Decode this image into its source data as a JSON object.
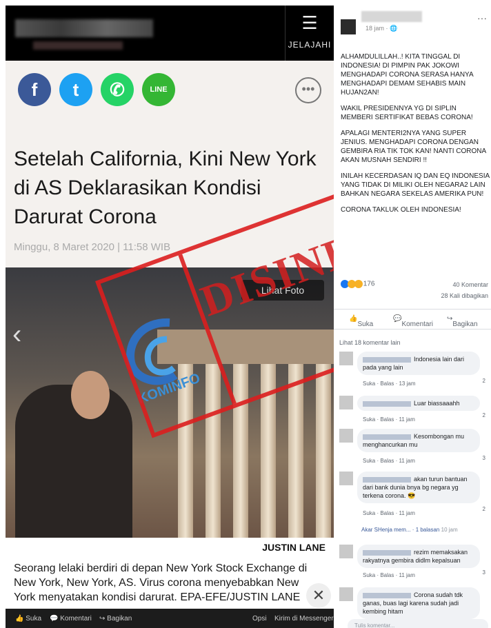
{
  "left_panel": {
    "explore_label": "JELAJAHI",
    "more_label": "•••",
    "share_icons": [
      "f",
      "t",
      "✆",
      "LINE"
    ],
    "headline": "Setelah California, Kini New York di AS Deklarasikan Kondisi Darurat Corona",
    "date": "Minggu, 8 Maret 2020 | 11:58 WIB",
    "view_photo": "Lihat Foto",
    "photo_credit": "JUSTIN LANE",
    "caption": "Seorang lelaki berdiri di depan New York Stock Exchange di New York, New York, AS. Virus corona menyebabkan New York menyatakan kondisi darurat. EPA-EFE/JUSTIN LANE",
    "stamp_text": "DISINFORMASI",
    "watermark": "KOMINFO",
    "bottom_bar": {
      "like": "Suka",
      "comment": "Komentari",
      "share": "Bagikan",
      "options": "Opsi",
      "messenger": "Kirim di Messenger"
    }
  },
  "post": {
    "time": "18 jam",
    "paragraphs": [
      "ALHAMDULILLAH..! KITA TINGGAL DI INDONESIA! DI PIMPIN PAK JOKOWI MENGHADAPI CORONA SERASA HANYA MENGHADAPI DEMAM SEHABIS MAIN HUJAN2AN!",
      "WAKIL PRESIDENNYA YG DI SIPLIN MEMBERI SERTIFIKAT BEBAS CORONA!",
      "APALAGI MENTERI2NYA YANG SUPER JENIUS. MENGHADAPI CORONA DENGAN GEMBIRA RIA TIK TOK KAN! NANTI CORONA AKAN MUSNAH SENDIRI !!",
      "INILAH KECERDASAN IQ DAN EQ INDONESIA YANG TIDAK DI MILIKI OLEH NEGARA2 LAIN BAHKAN NEGARA SEKELAS AMERIKA PUN!",
      "CORONA TAKLUK OLEH INDONESIA!"
    ],
    "reaction_count": "176",
    "comment_count": "40 Komentar",
    "share_count": "28 Kali dibagikan",
    "actions": {
      "like": "Suka",
      "comment": "Komentari",
      "share": "Bagikan"
    },
    "more_comments": "Lihat 18 komentar lain",
    "comments": [
      {
        "text": "Indonesia lain dari pada yang lain",
        "meta": "Suka · Balas · 13 jam",
        "reacts": "2"
      },
      {
        "text": "Luar biassaaahh",
        "meta": "Suka · Balas · 11 jam",
        "reacts": "2"
      },
      {
        "text": "Kesombongan mu menghancurkan mu",
        "meta": "Suka · Balas · 11 jam",
        "reacts": "3"
      },
      {
        "text": "akan turun bantuan dari bank dunia bnya bg negara yg terkena corona. 😎",
        "meta": "Suka · Balas · 11 jam",
        "reacts": "2"
      },
      {
        "text": "rezim memaksakan rakyatnya gembira didlm kepalsuan",
        "meta": "Suka · Balas · 11 jam",
        "reacts": "3"
      },
      {
        "text": "Corona sudah tdk ganas, buas lagi karena sudah jadi kembing hitam",
        "meta": "",
        "reacts": ""
      }
    ],
    "reply_link": "Akar SHenja mem... · 1 balasan",
    "reply_time": "10 jam",
    "write_placeholder": "Tulis komentar..."
  }
}
